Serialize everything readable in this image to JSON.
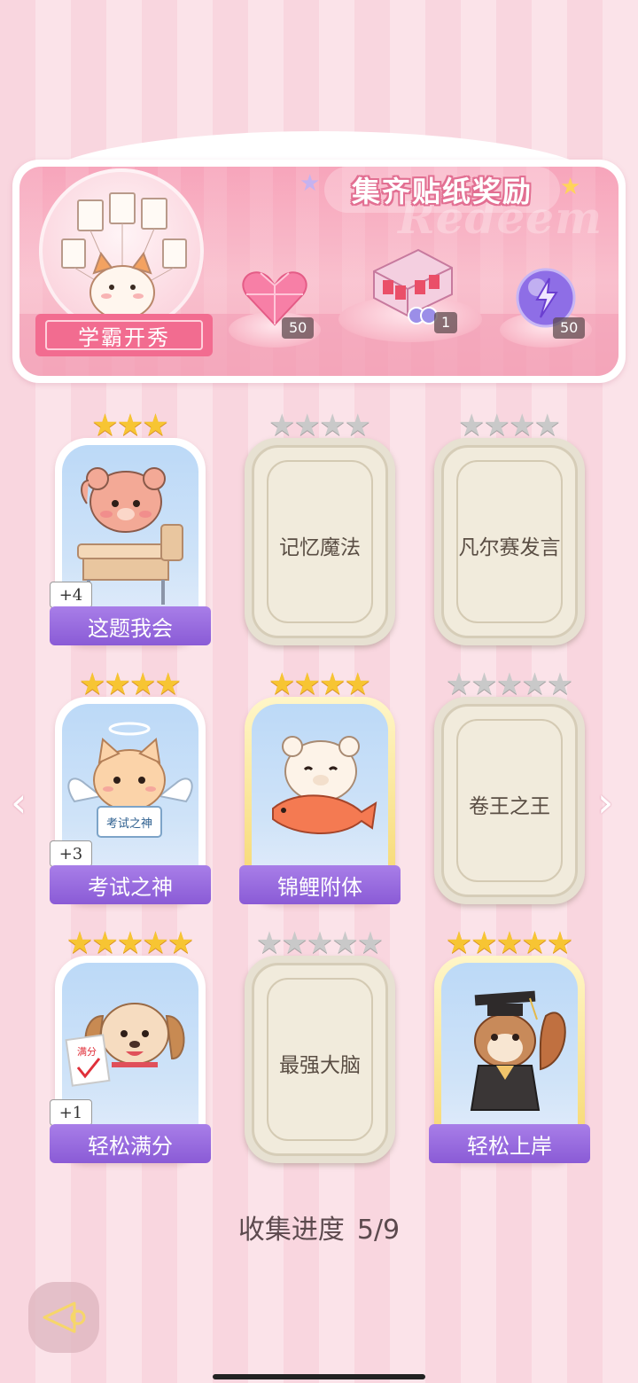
{
  "banner": {
    "title": "集齐贴纸奖励",
    "bg_word": "Redeem",
    "ribbon": "学霸开秀",
    "rewards": [
      {
        "icon": "pink-heart-gem-icon",
        "count": "50"
      },
      {
        "icon": "gift-box-icon",
        "count": "1"
      },
      {
        "icon": "purple-lightning-orb-icon",
        "count": "50"
      }
    ]
  },
  "cards": [
    {
      "title": "这题我会",
      "stars": 3,
      "stars_total": 3,
      "unlocked": true,
      "plus": "+4"
    },
    {
      "title": "记忆魔法",
      "stars": 0,
      "stars_total": 4,
      "unlocked": false
    },
    {
      "title": "凡尔赛发言",
      "stars": 0,
      "stars_total": 4,
      "unlocked": false
    },
    {
      "title": "考试之神",
      "stars": 4,
      "stars_total": 4,
      "unlocked": true,
      "plus": "+3",
      "sign": "考试之神"
    },
    {
      "title": "锦鲤附体",
      "stars": 4,
      "stars_total": 4,
      "unlocked": true,
      "gold": true
    },
    {
      "title": "卷王之王",
      "stars": 0,
      "stars_total": 5,
      "unlocked": false
    },
    {
      "title": "轻松满分",
      "stars": 5,
      "stars_total": 5,
      "unlocked": true,
      "plus": "+1",
      "paper": "满分"
    },
    {
      "title": "最强大脑",
      "stars": 0,
      "stars_total": 5,
      "unlocked": false
    },
    {
      "title": "轻松上岸",
      "stars": 5,
      "stars_total": 5,
      "unlocked": true,
      "gold": true
    }
  ],
  "progress": {
    "label": "收集进度",
    "value": "5/9"
  },
  "colors": {
    "accent": "#8a5bd6",
    "pink": "#f26c90",
    "gold_star": "#f7c533"
  }
}
